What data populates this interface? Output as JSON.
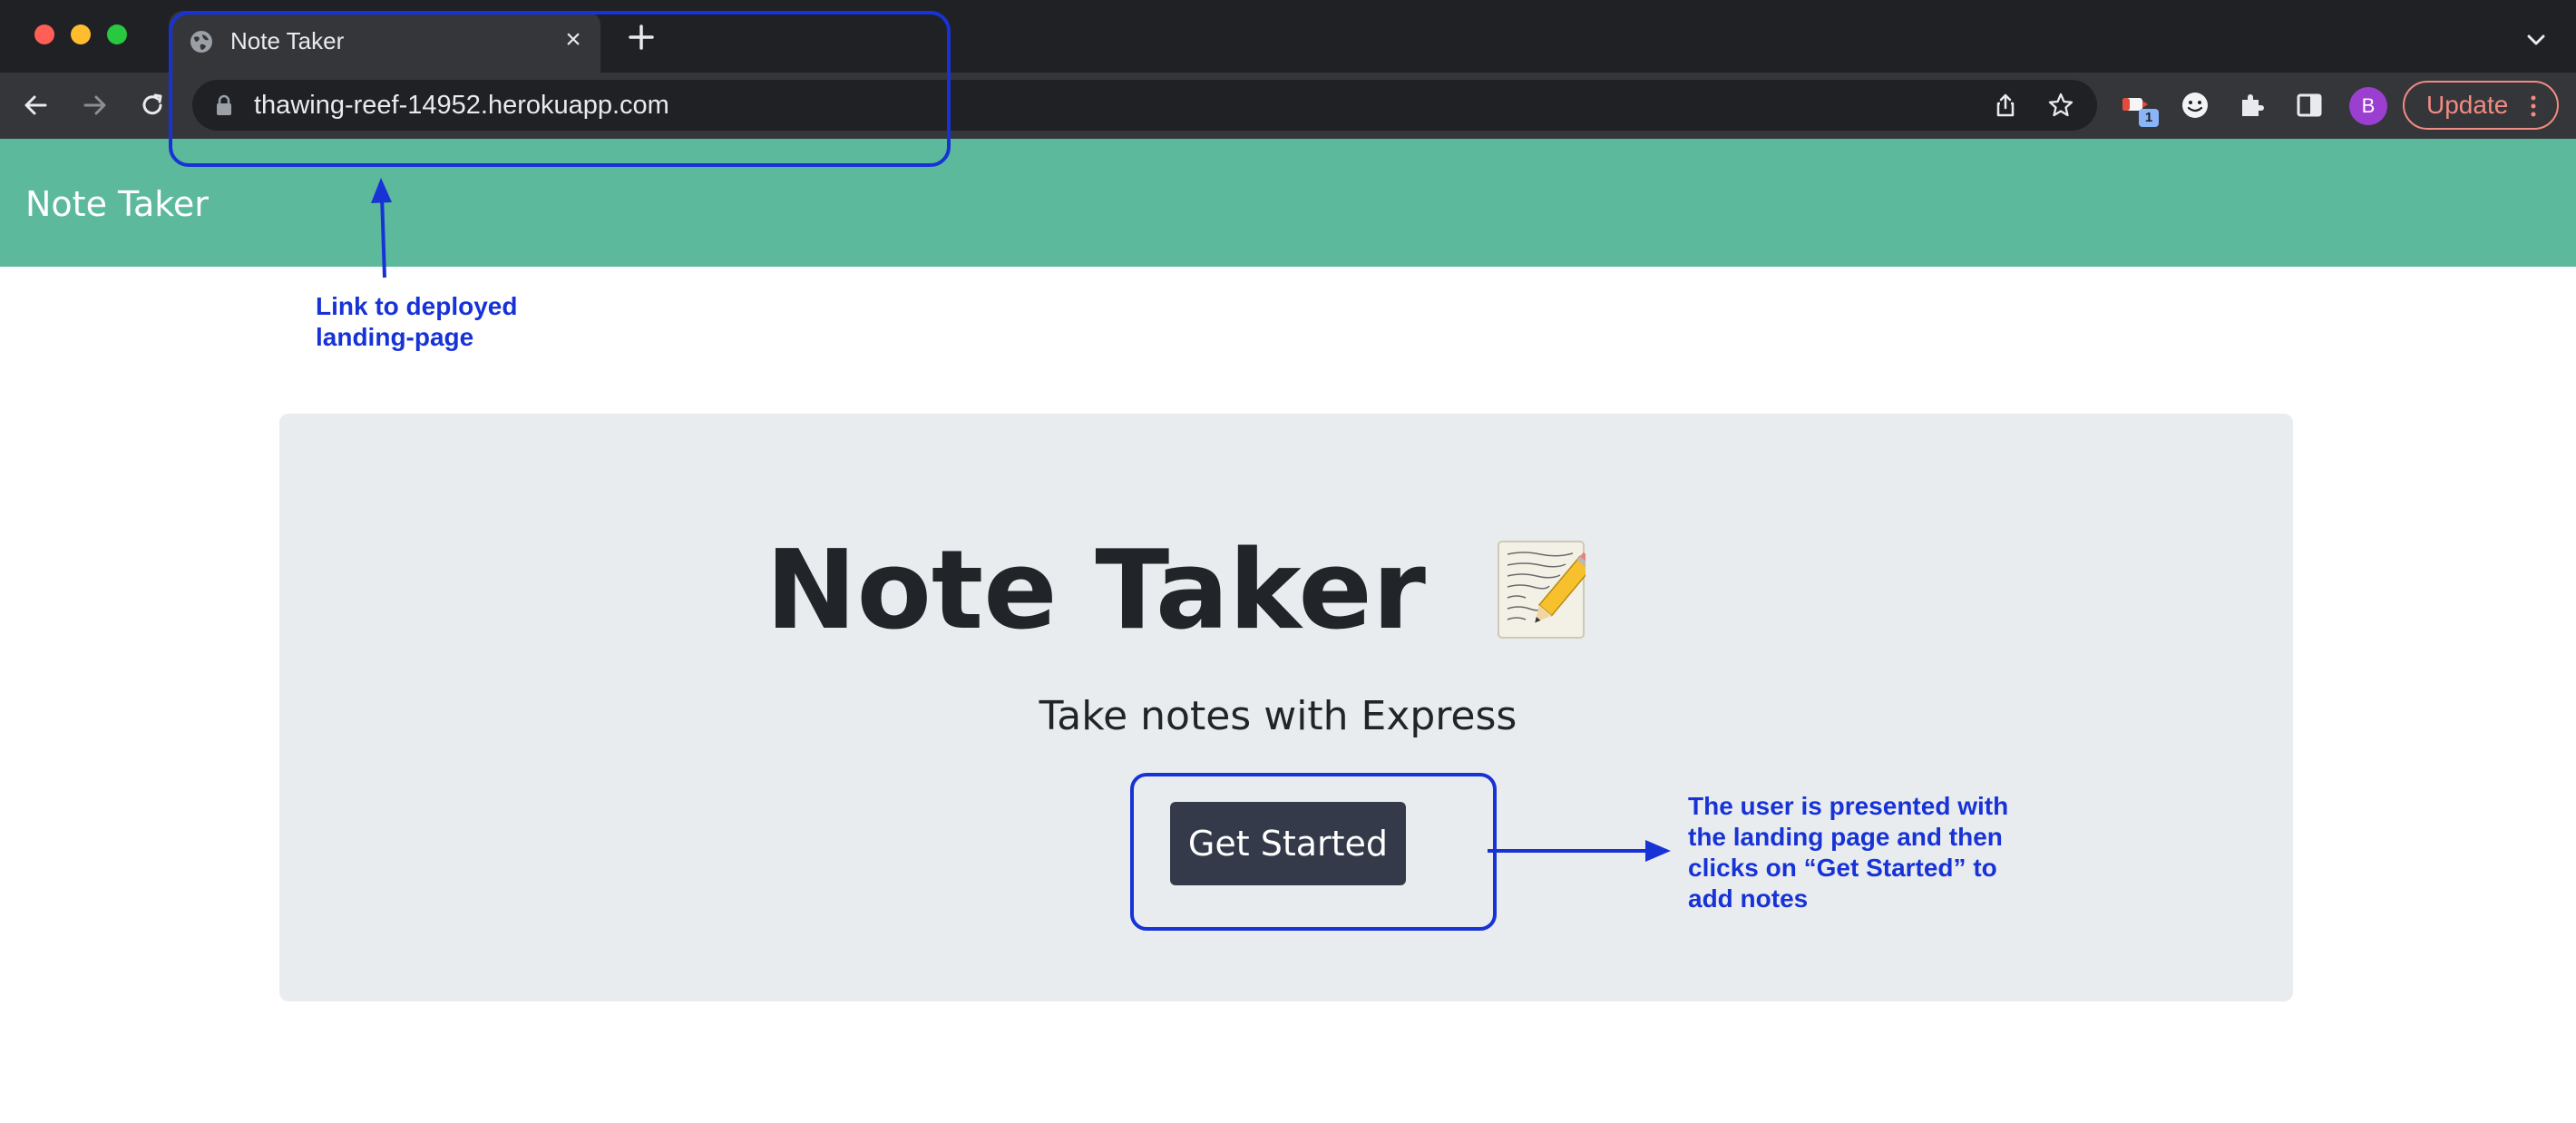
{
  "browser": {
    "tab": {
      "title": "Note Taker",
      "close_glyph": "×",
      "favicon": "globe-icon"
    },
    "new_tab_icon": "plus-icon",
    "address_bar": {
      "url": "thawing-reef-14952.herokuapp.com",
      "lock_icon": "lock-icon"
    },
    "extension_badge_count": "1",
    "profile_initial": "B",
    "update_label": "Update"
  },
  "page": {
    "navbar": {
      "brand": "Note Taker",
      "background": "#5cb99c"
    },
    "hero": {
      "title": "Note Taker",
      "emoji": "memo-icon",
      "lead": "Take notes with Express",
      "button_label": "Get Started"
    }
  },
  "annotations": {
    "link_note": [
      "Link to deployed",
      "landing-page"
    ],
    "button_note": [
      "The user is presented with",
      "the landing page and then",
      "clicks on “Get Started” to",
      "add notes"
    ],
    "color": "#1733d6"
  }
}
